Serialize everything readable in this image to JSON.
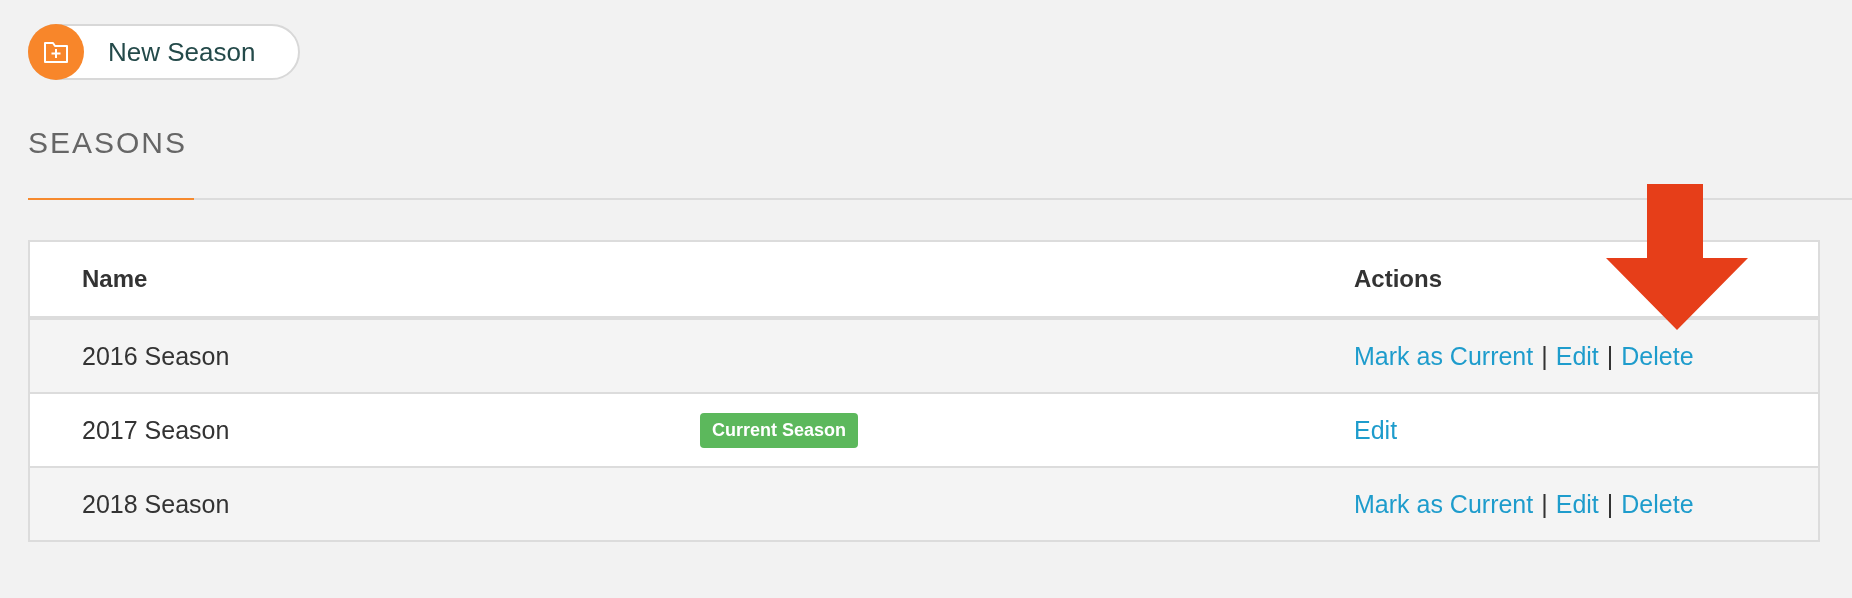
{
  "new_season_button": {
    "label": "New Season"
  },
  "section_title": "SEASONS",
  "table": {
    "columns": [
      "Name",
      "Actions"
    ],
    "rows": [
      {
        "name": "2016 Season",
        "actions": [
          {
            "kind": "link",
            "text": "Mark as Current"
          },
          {
            "kind": "separator",
            "text": "|"
          },
          {
            "kind": "link",
            "text": "Edit"
          },
          {
            "kind": "separator",
            "text": "|"
          },
          {
            "kind": "link",
            "text": "Delete"
          }
        ]
      },
      {
        "name": "2017 Season",
        "badge": "Current Season",
        "actions": [
          {
            "kind": "link",
            "text": "Edit"
          }
        ]
      },
      {
        "name": "2018 Season",
        "actions": [
          {
            "kind": "link",
            "text": "Mark as Current"
          },
          {
            "kind": "separator",
            "text": "|"
          },
          {
            "kind": "link",
            "text": "Edit"
          },
          {
            "kind": "separator",
            "text": "|"
          },
          {
            "kind": "link",
            "text": "Delete"
          }
        ]
      }
    ]
  }
}
